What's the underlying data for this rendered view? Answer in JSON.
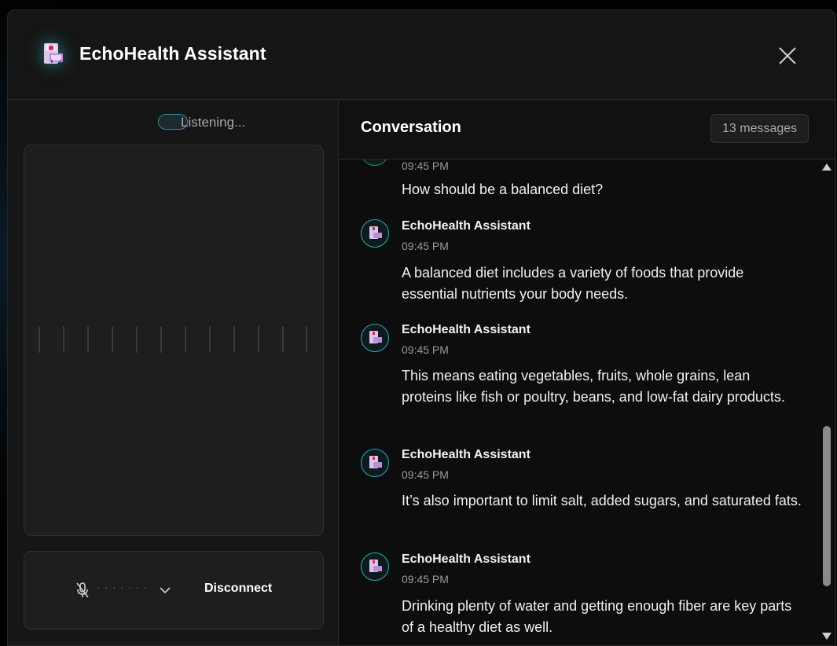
{
  "header": {
    "title": "EchoHealth Assistant",
    "logo_icon": "medical-kiosk-icon",
    "close_icon": "close-icon"
  },
  "left_panel": {
    "status": "Listening...",
    "controls": {
      "mic_icon": "mic-muted-icon",
      "level_dots": "· · · · · · ·",
      "chevron_icon": "chevron-down-icon",
      "disconnect_label": "Disconnect"
    }
  },
  "conversation": {
    "title": "Conversation",
    "message_count": "13 messages",
    "messages": [
      {
        "sender": "",
        "time": "09:45 PM",
        "text": "How should be a balanced diet?"
      },
      {
        "sender": "EchoHealth Assistant",
        "time": "09:45 PM",
        "text": "A balanced diet includes a variety of foods that provide essential nutrients your body needs."
      },
      {
        "sender": "EchoHealth Assistant",
        "time": "09:45 PM",
        "text": "This means eating vegetables, fruits, whole grains, lean proteins like fish or poultry, beans, and low-fat dairy products."
      },
      {
        "sender": "EchoHealth Assistant",
        "time": "09:45 PM",
        "text": "It’s also important to limit salt, added sugars, and saturated fats."
      },
      {
        "sender": "EchoHealth Assistant",
        "time": "09:45 PM",
        "text": "Drinking plenty of water and getting enough fiber are key parts of a healthy diet as well."
      }
    ]
  },
  "colors": {
    "accent": "#2aa8c0",
    "background": "#000000",
    "panel": "#161616",
    "chat_bg": "#0d0d0d"
  }
}
